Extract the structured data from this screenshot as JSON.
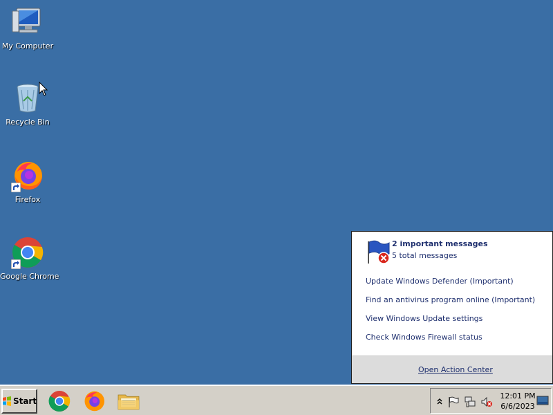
{
  "desktop": {
    "icons": [
      {
        "label": "My Computer"
      },
      {
        "label": "Recycle Bin"
      },
      {
        "label": "Firefox"
      },
      {
        "label": "Google Chrome"
      }
    ]
  },
  "action_center": {
    "title": "2 important messages",
    "subtitle": "5 total messages",
    "links": [
      "Update Windows Defender (Important)",
      "Find an antivirus program online (Important)",
      "View Windows Update settings",
      "Check Windows Firewall status"
    ],
    "footer_link": "Open Action Center"
  },
  "taskbar": {
    "start_label": "Start",
    "pinned": [
      "chrome-icon",
      "firefox-icon",
      "file-explorer-icon"
    ],
    "tray_icons": [
      "show-hidden-icons-chevron",
      "action-center-flag-icon",
      "network-icon",
      "volume-muted-icon"
    ],
    "clock": {
      "time": "12:01 PM",
      "date": "6/6/2023"
    }
  },
  "colors": {
    "desktop_background": "#3a6ea5",
    "taskbar_background": "#d4d0c8",
    "link_color": "#1e2f6e"
  }
}
